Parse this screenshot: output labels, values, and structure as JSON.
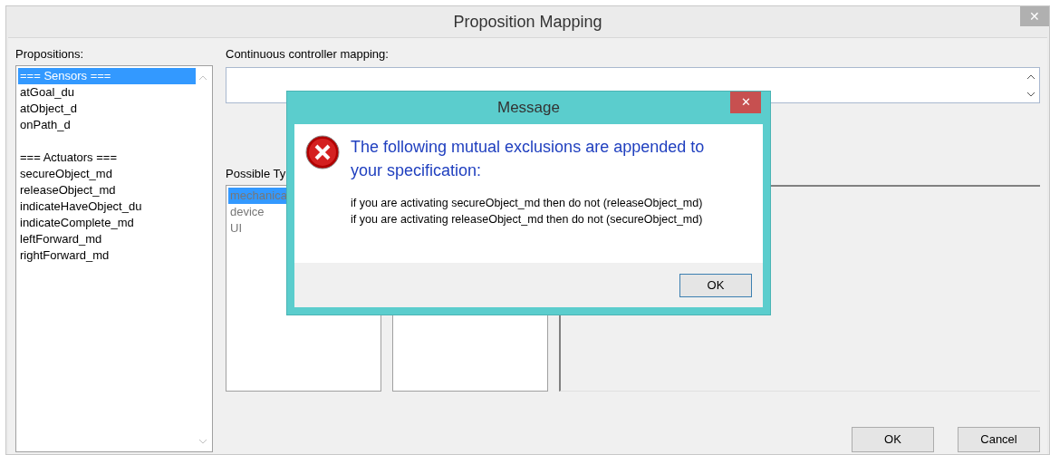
{
  "window": {
    "title": "Proposition Mapping",
    "close": "✕"
  },
  "propositions": {
    "label": "Propositions:",
    "groups": [
      {
        "items": [
          {
            "text": "=== Sensors ===",
            "selected": true
          },
          {
            "text": "atGoal_du",
            "selected": false
          },
          {
            "text": "atObject_d",
            "selected": false
          },
          {
            "text": "onPath_d",
            "selected": false
          }
        ]
      },
      {
        "items": [
          {
            "text": "=== Actuators ===",
            "selected": false
          },
          {
            "text": "secureObject_md",
            "selected": false
          },
          {
            "text": "releaseObject_md",
            "selected": false
          },
          {
            "text": "indicateHaveObject_du",
            "selected": false
          },
          {
            "text": "indicateComplete_md",
            "selected": false
          },
          {
            "text": "leftForward_md",
            "selected": false
          },
          {
            "text": "rightForward_md",
            "selected": false
          }
        ]
      }
    ]
  },
  "mapping": {
    "label": "Continuous controller mapping:"
  },
  "types": {
    "label": "Possible Ty",
    "items": [
      {
        "text": "mechanica",
        "selected": true
      },
      {
        "text": "device",
        "selected": false
      },
      {
        "text": "UI",
        "selected": false
      }
    ]
  },
  "buttons": [
    "OK",
    "Cancel"
  ],
  "message": {
    "title": "Message",
    "close": "✕",
    "heading": "The following mutual exclusions are appended to your specification:",
    "lines": [
      "if you are activating secureObject_md then do not (releaseObject_md)",
      "if you are activating releaseObject_md then do not (secureObject_md)"
    ],
    "button": "OK"
  }
}
